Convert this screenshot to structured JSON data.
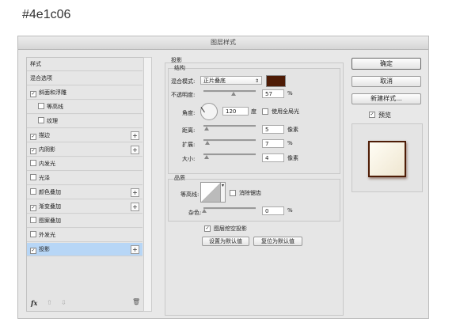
{
  "caption": "#4e1c06",
  "dialog": {
    "title": "图层样式"
  },
  "styles": [
    {
      "label": "样式",
      "checkbox": false,
      "checked": false,
      "plus": false,
      "indent": false
    },
    {
      "label": "混合选项",
      "checkbox": false,
      "checked": false,
      "plus": false,
      "indent": false
    },
    {
      "label": "斜面和浮雕",
      "checkbox": true,
      "checked": true,
      "plus": false,
      "indent": false
    },
    {
      "label": "等高线",
      "checkbox": true,
      "checked": false,
      "plus": false,
      "indent": true
    },
    {
      "label": "纹理",
      "checkbox": true,
      "checked": false,
      "plus": false,
      "indent": true
    },
    {
      "label": "描边",
      "checkbox": true,
      "checked": true,
      "plus": true,
      "indent": false
    },
    {
      "label": "内阴影",
      "checkbox": true,
      "checked": true,
      "plus": true,
      "indent": false
    },
    {
      "label": "内发光",
      "checkbox": true,
      "checked": false,
      "plus": false,
      "indent": false
    },
    {
      "label": "光泽",
      "checkbox": true,
      "checked": false,
      "plus": false,
      "indent": false
    },
    {
      "label": "颜色叠加",
      "checkbox": true,
      "checked": false,
      "plus": true,
      "indent": false
    },
    {
      "label": "渐变叠加",
      "checkbox": true,
      "checked": true,
      "plus": true,
      "indent": false
    },
    {
      "label": "图案叠加",
      "checkbox": true,
      "checked": false,
      "plus": false,
      "indent": false
    },
    {
      "label": "外发光",
      "checkbox": true,
      "checked": false,
      "plus": false,
      "indent": false
    },
    {
      "label": "投影",
      "checkbox": true,
      "checked": true,
      "plus": true,
      "indent": false,
      "selected": true
    }
  ],
  "footer": {
    "fx": "fx"
  },
  "shadow": {
    "section": "投影",
    "structure": "结构",
    "blend_label": "混合模式:",
    "blend_value": "正片叠底",
    "color": "#4e1c06",
    "opacity_label": "不透明度:",
    "opacity": "57",
    "opacity_unit": "%",
    "opacity_fraction": 0.57,
    "angle_label": "角度:",
    "angle": "120",
    "angle_unit": "度",
    "global_light": "使用全局光",
    "distance_label": "距离:",
    "distance": "5",
    "distance_unit": "像素",
    "spread_label": "扩展:",
    "spread": "7",
    "spread_unit": "%",
    "size_label": "大小:",
    "size": "4",
    "size_unit": "像素",
    "quality": "品质",
    "contour_label": "等高线:",
    "antialias": "消除锯齿",
    "noise_label": "杂色:",
    "noise": "0",
    "noise_unit": "%",
    "knockout": "图层挖空投影",
    "set_default": "设置为默认值",
    "reset_default": "复位为默认值"
  },
  "buttons": {
    "ok": "确定",
    "cancel": "取消",
    "new_style": "新建样式...",
    "preview": "预览"
  }
}
